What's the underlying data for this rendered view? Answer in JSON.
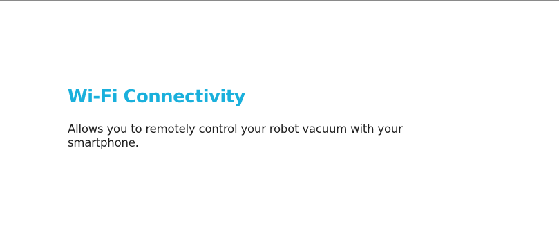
{
  "colors": {
    "heading": "#1ab0dc",
    "body_text": "#1e1e1e",
    "background": "#ffffff",
    "rule": "#8a8a8a"
  },
  "feature": {
    "title": "Wi-Fi Connectivity",
    "description": "Allows you to remotely control your robot vacuum with your smartphone."
  }
}
